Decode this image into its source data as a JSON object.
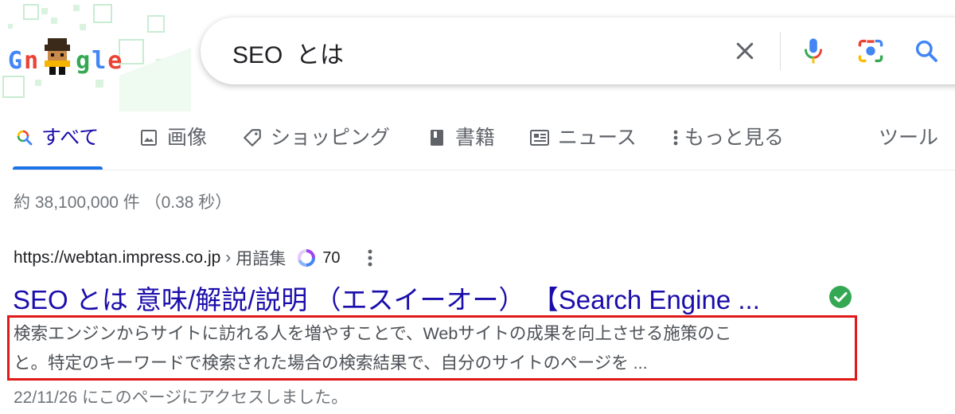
{
  "search": {
    "query": "SEO  とは"
  },
  "logo": {
    "letters": [
      "G",
      "n",
      "g",
      "l",
      "e"
    ]
  },
  "tabs": [
    {
      "label": "すべて",
      "icon": "search-icon",
      "active": true
    },
    {
      "label": "画像",
      "icon": "image-icon"
    },
    {
      "label": "ショッピング",
      "icon": "tag-icon"
    },
    {
      "label": "書籍",
      "icon": "book-icon"
    },
    {
      "label": "ニュース",
      "icon": "news-icon"
    },
    {
      "label": "もっと見る",
      "icon": "more-vert-icon"
    },
    {
      "label": "ツール"
    }
  ],
  "stats": "約 38,100,000 件 （0.38 秒）",
  "result": {
    "url": "https://webtan.impress.co.jp",
    "separator": "›",
    "breadcrumb": "用語集",
    "score": "70",
    "title": "SEO とは 意味/解説/説明 （エスイーオー） 【Search Engine ...",
    "snippet_line1": "検索エンジンからサイトに訪れる人を増やすことで、Webサイトの成果を向上させる施策のこ",
    "snippet_line2": "と。特定のキーワードで検索された場合の検索結果で、自分のサイトのページを ...",
    "visited": "22/11/26 にこのページにアクセスしました。"
  },
  "colors": {
    "link": "#1a0dab",
    "accent": "#1a73e8",
    "highlight_box": "#e01919",
    "verified": "#34a853"
  }
}
